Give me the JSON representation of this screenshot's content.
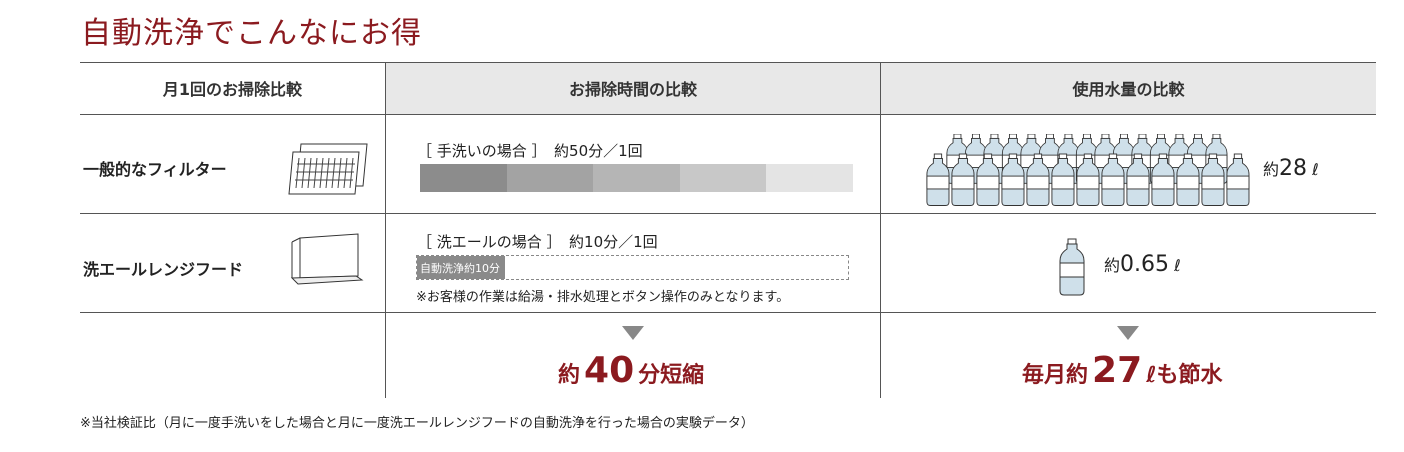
{
  "title": "自動洗浄でこんなにお得",
  "headers": {
    "col1": "月1回のお掃除比較",
    "col2": "お掃除時間の比較",
    "col3": "使用水量の比較"
  },
  "rows": {
    "filter": {
      "label": "一般的なフィルター",
      "case_label": "［ 手洗いの場合 ］　約50分／1回",
      "water_prefix": "約",
      "water_value": "28",
      "water_unit": "ℓ",
      "time_minutes": 50,
      "bottles": 28
    },
    "hood": {
      "label": "洗エールレンジフード",
      "case_label": "［ 洗エールの場合 ］　約10分／1回",
      "bar_text": "自動洗浄約10分",
      "note": "※お客様の作業は給湯・排水処理とボタン操作のみとなります。",
      "water_prefix": "約",
      "water_value": "0.65",
      "water_unit": "ℓ",
      "time_minutes": 10,
      "bottles": 1
    }
  },
  "results": {
    "time": {
      "prefix": "約",
      "value": "40",
      "suffix": "分短縮"
    },
    "water": {
      "prefix": "毎月約",
      "value": "27",
      "suffix": "ℓも節水"
    }
  },
  "footnote": "※当社検証比（月に一度手洗いをした場合と月に一度洗エールレンジフードの自動洗浄を行った場合の実験データ）",
  "colors": {
    "accent": "#8b1a1f",
    "bar_segments": [
      "#8c8c8c",
      "#a3a3a3",
      "#b5b5b5",
      "#c8c8c8",
      "#e4e4e4"
    ]
  }
}
